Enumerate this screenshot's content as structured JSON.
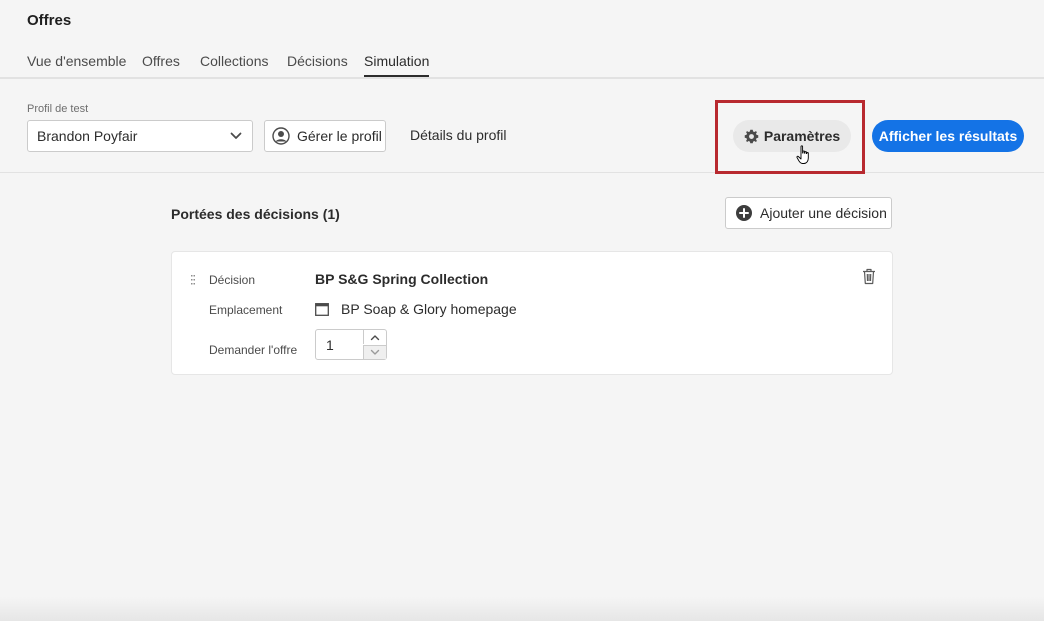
{
  "app": {
    "title": "Offres"
  },
  "tabs": [
    {
      "label": "Vue d'ensemble"
    },
    {
      "label": "Offres"
    },
    {
      "label": "Collections"
    },
    {
      "label": "Décisions"
    },
    {
      "label": "Simulation",
      "active": true
    }
  ],
  "toolbar": {
    "profile_label": "Profil de test",
    "profile_value": "Brandon Poyfair",
    "manage_label": "Gérer le profil",
    "details_label": "Détails du profil",
    "params_label": "Paramètres",
    "show_results_label": "Afficher les résultats"
  },
  "scopes": {
    "title": "Portées des décisions (1)",
    "add_label": "Ajouter une décision",
    "card": {
      "decision_label": "Décision",
      "decision_value": "BP S&G Spring Collection",
      "placement_label": "Emplacement",
      "placement_value": "BP Soap & Glory homepage",
      "request_label": "Demander l'offre",
      "request_value": "1"
    }
  },
  "colors": {
    "accent": "#1473e6",
    "highlight": "#b8292f"
  }
}
